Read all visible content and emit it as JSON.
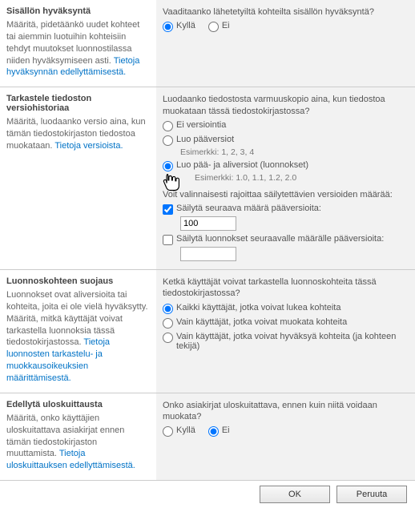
{
  "sections": {
    "approval": {
      "title": "Sisällön hyväksyntä",
      "desc_a": "Määritä, pidetäänkö uudet kohteet tai aiemmin luotuihin kohteisiin tehdyt muutokset luonnostilassa niiden hyväksymiseen asti. ",
      "link": "Tietoja hyväksynnän edellyttämisestä.",
      "question": "Vaaditaanko lähetetyiltä kohteilta sisällön hyväksyntä?",
      "opt_yes": "Kyllä",
      "opt_no": "Ei"
    },
    "versioning": {
      "title": "Tarkastele tiedoston versiohistoriaa",
      "desc_a": "Määritä, luodaanko versio aina, kun tämän tiedostokirjaston tiedostoa muokataan. ",
      "link": "Tietoja versioista.",
      "question": "Luodaanko tiedostosta varmuuskopio aina, kun tiedostoa muokataan tässä tiedostokirjastossa?",
      "opt_none": "Ei versiointia",
      "opt_major": "Luo pääversiot",
      "opt_major_ex": "Esimerkki: 1, 2, 3, 4",
      "opt_minor": "Luo pää- ja aliversiot (luonnokset)",
      "opt_minor_ex": "Esimerkki: 1.0, 1.1, 1.2, 2.0",
      "limit_intro": "Voit valinnaisesti rajoittaa säilytettävien versioiden määrää:",
      "chk_major": "Säilytä seuraava määrä pääversioita:",
      "val_major": "100",
      "chk_minor": "Säilytä luonnokset seuraavalle määrälle pääversioita:",
      "val_minor": ""
    },
    "draft": {
      "title": "Luonnoskohteen suojaus",
      "desc_a": "Luonnokset ovat aliversioita tai kohteita, joita ei ole vielä hyväksytty. Määritä, mitkä käyttäjät voivat tarkastella luonnoksia tässä tiedostokirjastossa. ",
      "link": "Tietoja luonnosten tarkastelu- ja muokkausoikeuksien määrittämisestä.",
      "question": "Ketkä käyttäjät voivat tarkastella luonnoskohteita tässä tiedostokirjastossa?",
      "opt1": "Kaikki käyttäjät, jotka voivat lukea kohteita",
      "opt2": "Vain käyttäjät, jotka voivat muokata kohteita",
      "opt3": "Vain käyttäjät, jotka voivat hyväksyä kohteita (ja kohteen tekijä)"
    },
    "checkout": {
      "title": "Edellytä uloskuittausta",
      "desc_a": "Määritä, onko käyttäjien uloskuitattava asiakirjat ennen tämän tiedostokirjaston muuttamista. ",
      "link": "Tietoja uloskuittauksen edellyttämisestä.",
      "question": "Onko asiakirjat uloskuitattava, ennen kuin niitä voidaan muokata?",
      "opt_yes": "Kyllä",
      "opt_no": "Ei"
    }
  },
  "footer": {
    "ok": "OK",
    "cancel": "Peruuta"
  }
}
